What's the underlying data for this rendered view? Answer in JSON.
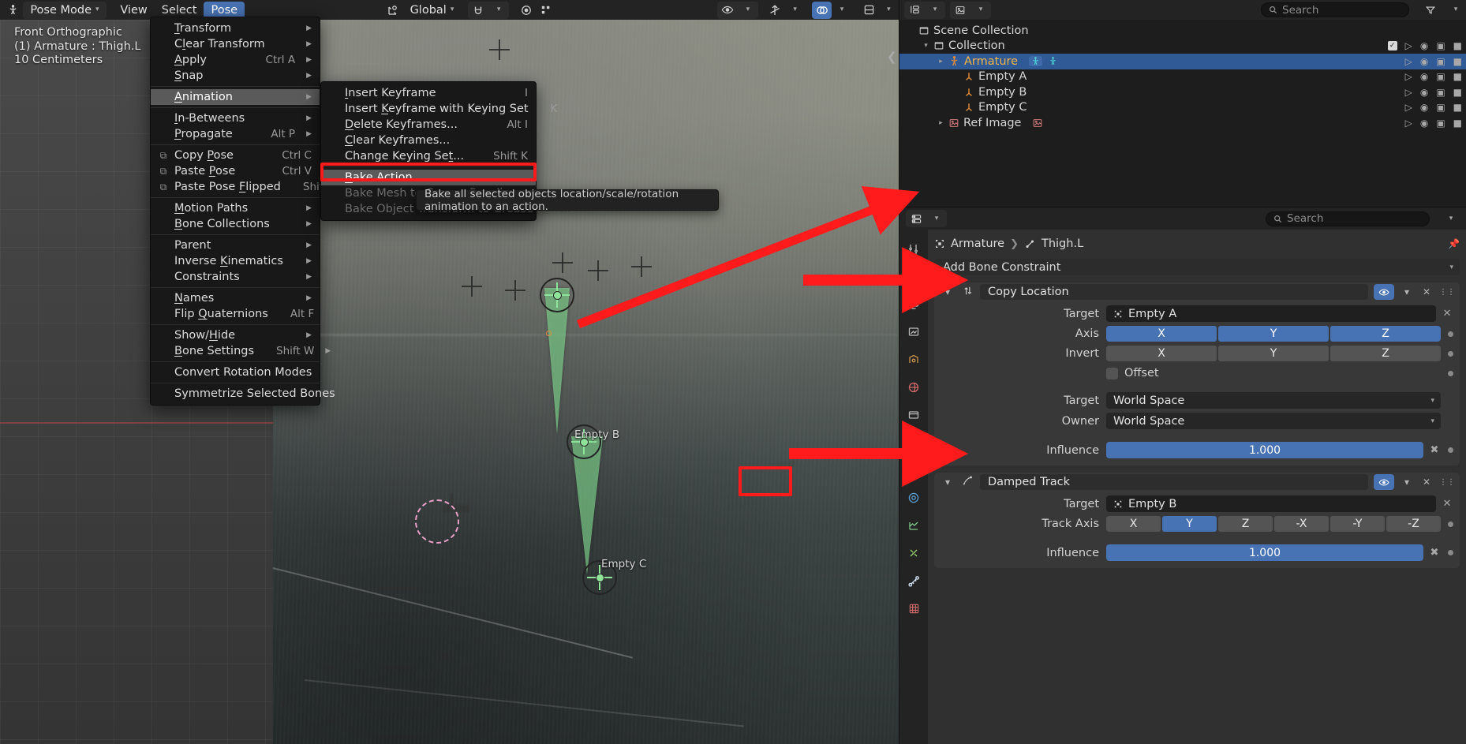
{
  "viewport_header": {
    "mode": "Pose Mode",
    "menus": [
      "View",
      "Select",
      "Pose"
    ],
    "active_menu": "Pose",
    "transform_orientation": "Global",
    "icons": [
      "armature-mode-icon",
      "transform-orientation-icon",
      "snap-magnet-icon",
      "proportional-edit-icon",
      "visibility-selector-icon",
      "show-gizmo-icon",
      "show-overlays-icon",
      "xray-toggle-icon",
      "shading-wireframe-icon",
      "shading-solid-icon",
      "shading-material-icon",
      "shading-rendered-icon"
    ]
  },
  "viewport_overlay": {
    "view_name": "Front Orthographic",
    "object_line": "(1) Armature : Thigh.L",
    "grid_scale": "10 Centimeters"
  },
  "viewport_objects": {
    "empty_a_label": "Empty A",
    "empty_b_label": "Empty B",
    "empty_c_label": "Empty C"
  },
  "pose_menu": {
    "title": "Pose",
    "groups": [
      [
        {
          "label": "Transform",
          "accel": "",
          "arrow": true,
          "icon": ""
        },
        {
          "label": "Clear Transform",
          "accel": "",
          "arrow": true,
          "icon": ""
        },
        {
          "label": "Apply",
          "accel": "Ctrl A",
          "arrow": true,
          "icon": ""
        },
        {
          "label": "Snap",
          "accel": "",
          "arrow": true,
          "icon": ""
        }
      ],
      [
        {
          "label": "Animation",
          "accel": "",
          "arrow": true,
          "icon": "",
          "highlight": true
        }
      ],
      [
        {
          "label": "In-Betweens",
          "accel": "",
          "arrow": true,
          "icon": ""
        },
        {
          "label": "Propagate",
          "accel": "Alt P",
          "arrow": true,
          "icon": ""
        }
      ],
      [
        {
          "label": "Copy Pose",
          "accel": "Ctrl C",
          "arrow": false,
          "icon": "copy-icon"
        },
        {
          "label": "Paste Pose",
          "accel": "Ctrl V",
          "arrow": false,
          "icon": "paste-icon"
        },
        {
          "label": "Paste Pose Flipped",
          "accel": "Shift Ctrl V",
          "arrow": false,
          "icon": "paste-flipped-icon"
        }
      ],
      [
        {
          "label": "Motion Paths",
          "accel": "",
          "arrow": true,
          "icon": ""
        },
        {
          "label": "Bone Collections",
          "accel": "",
          "arrow": true,
          "icon": ""
        }
      ],
      [
        {
          "label": "Parent",
          "accel": "",
          "arrow": true,
          "icon": ""
        },
        {
          "label": "Inverse Kinematics",
          "accel": "",
          "arrow": true,
          "icon": ""
        },
        {
          "label": "Constraints",
          "accel": "",
          "arrow": true,
          "icon": ""
        }
      ],
      [
        {
          "label": "Names",
          "accel": "",
          "arrow": true,
          "icon": ""
        },
        {
          "label": "Flip Quaternions",
          "accel": "Alt F",
          "arrow": false,
          "icon": ""
        }
      ],
      [
        {
          "label": "Show/Hide",
          "accel": "",
          "arrow": true,
          "icon": ""
        },
        {
          "label": "Bone Settings",
          "accel": "Shift W",
          "arrow": true,
          "icon": ""
        }
      ],
      [
        {
          "label": "Convert Rotation Modes",
          "accel": "",
          "arrow": false,
          "icon": ""
        }
      ],
      [
        {
          "label": "Symmetrize Selected Bones",
          "accel": "",
          "arrow": false,
          "icon": ""
        }
      ]
    ]
  },
  "animation_submenu": {
    "items": [
      {
        "label": "Insert Keyframe",
        "accel": "I",
        "disabled": false,
        "highlight": false
      },
      {
        "label": "Insert Keyframe with Keying Set",
        "accel": "K",
        "disabled": false,
        "highlight": false
      },
      {
        "label": "Delete Keyframes...",
        "accel": "Alt I",
        "disabled": false,
        "highlight": false
      },
      {
        "label": "Clear Keyframes...",
        "accel": "",
        "disabled": false,
        "highlight": false
      },
      {
        "label": "Change Keying Set...",
        "accel": "Shift K",
        "disabled": false,
        "highlight": false
      },
      {
        "label": "Bake Action...",
        "accel": "",
        "disabled": false,
        "highlight": true
      },
      {
        "label": "Bake Mesh to Grease Pencil",
        "accel": "",
        "disabled": true,
        "highlight": false
      },
      {
        "label": "Bake Object Transform to Grease Pencil",
        "accel": "",
        "disabled": true,
        "highlight": false
      }
    ]
  },
  "tooltip": {
    "text": "Bake all selected objects location/scale/rotation animation to an action."
  },
  "outliner": {
    "search_placeholder": "Search",
    "rows": [
      {
        "label": "Scene Collection",
        "indent": 0,
        "icon": "collection-icon",
        "selected": false,
        "toggle": ""
      },
      {
        "label": "Collection",
        "indent": 1,
        "icon": "collection-icon",
        "selected": false,
        "toggle": "v"
      },
      {
        "label": "Armature",
        "indent": 2,
        "icon": "armature-icon",
        "selected": true,
        "toggle": ">"
      },
      {
        "label": "Empty A",
        "indent": 3,
        "icon": "empty-axes-icon",
        "selected": false,
        "toggle": ""
      },
      {
        "label": "Empty B",
        "indent": 3,
        "icon": "empty-axes-icon",
        "selected": false,
        "toggle": ""
      },
      {
        "label": "Empty C",
        "indent": 3,
        "icon": "empty-axes-icon",
        "selected": false,
        "toggle": ""
      },
      {
        "label": "Ref Image",
        "indent": 2,
        "icon": "image-icon",
        "selected": false,
        "toggle": ">"
      }
    ]
  },
  "properties": {
    "search_placeholder": "Search",
    "breadcrumb": [
      "Armature",
      "Thigh.L"
    ],
    "add_constraint_label": "Add Bone Constraint",
    "constraints": [
      {
        "name": "Copy Location",
        "icon": "copy-location-icon",
        "target_label": "Target",
        "target_value": "Empty A",
        "axis_label": "Axis",
        "axis_options": [
          "X",
          "Y",
          "Z"
        ],
        "axis_enabled": [
          "X",
          "Y",
          "Z"
        ],
        "invert_label": "Invert",
        "invert_options": [
          "X",
          "Y",
          "Z"
        ],
        "invert_enabled": [],
        "offset_label": "Offset",
        "offset_checked": false,
        "space_target_label": "Target",
        "space_target_value": "World Space",
        "space_owner_label": "Owner",
        "space_owner_value": "World Space",
        "influence_label": "Influence",
        "influence_value": "1.000"
      },
      {
        "name": "Damped Track",
        "icon": "damped-track-icon",
        "target_label": "Target",
        "target_value": "Empty B",
        "track_axis_label": "Track Axis",
        "track_axis_options": [
          "X",
          "Y",
          "Z",
          "-X",
          "-Y",
          "-Z"
        ],
        "track_axis_selected": "Y",
        "influence_label": "Influence",
        "influence_value": "1.000"
      }
    ]
  },
  "colors": {
    "accent_blue": "#4772b3",
    "highlight_red": "#ff1b1b",
    "bone_green": "#89e297",
    "selected_orange": "#ffb546"
  }
}
